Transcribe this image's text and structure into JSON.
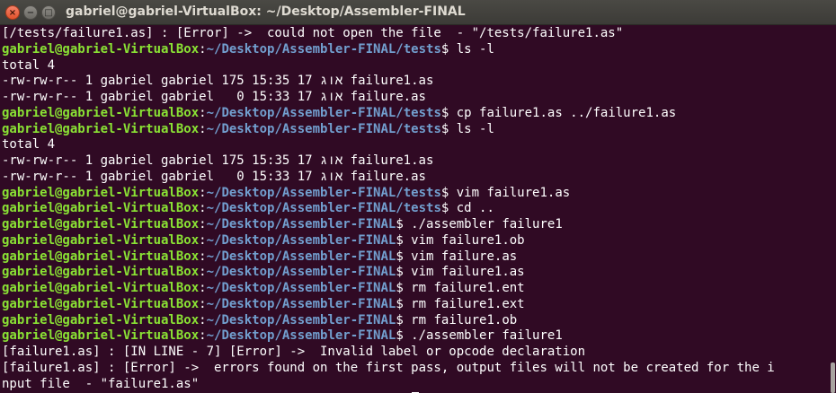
{
  "window": {
    "title": "gabriel@gabriel-VirtualBox: ~/Desktop/Assembler-FINAL",
    "close_glyph": "×",
    "min_glyph": "−",
    "max_glyph": "□"
  },
  "prompt": {
    "user_host": "gabriel@gabriel-VirtualBox",
    "sep": ":"
  },
  "lines": [
    {
      "kind": "out",
      "text": "[/tests/failure1.as] : [Error] ->  could not open the file  - \"/tests/failure1.as\""
    },
    {
      "kind": "cmd",
      "path": "~/Desktop/Assembler-FINAL/tests",
      "cmd": "$ ls -l"
    },
    {
      "kind": "out",
      "text": "total 4"
    },
    {
      "kind": "out",
      "text": "-rw-rw-r-- 1 gabriel gabriel 175 אוג 17 15:35 failure1.as"
    },
    {
      "kind": "out",
      "text": "-rw-rw-r-- 1 gabriel gabriel   0 אוג 17 15:33 failure.as"
    },
    {
      "kind": "cmd",
      "path": "~/Desktop/Assembler-FINAL/tests",
      "cmd": "$ cp failure1.as ../failure1.as"
    },
    {
      "kind": "cmd",
      "path": "~/Desktop/Assembler-FINAL/tests",
      "cmd": "$ ls -l"
    },
    {
      "kind": "out",
      "text": "total 4"
    },
    {
      "kind": "out",
      "text": "-rw-rw-r-- 1 gabriel gabriel 175 אוג 17 15:35 failure1.as"
    },
    {
      "kind": "out",
      "text": "-rw-rw-r-- 1 gabriel gabriel   0 אוג 17 15:33 failure.as"
    },
    {
      "kind": "cmd",
      "path": "~/Desktop/Assembler-FINAL/tests",
      "cmd": "$ vim failure1.as"
    },
    {
      "kind": "cmd",
      "path": "~/Desktop/Assembler-FINAL/tests",
      "cmd": "$ cd .."
    },
    {
      "kind": "cmd",
      "path": "~/Desktop/Assembler-FINAL",
      "cmd": "$ ./assembler failure1"
    },
    {
      "kind": "cmd",
      "path": "~/Desktop/Assembler-FINAL",
      "cmd": "$ vim failure1.ob"
    },
    {
      "kind": "cmd",
      "path": "~/Desktop/Assembler-FINAL",
      "cmd": "$ vim failure.as"
    },
    {
      "kind": "cmd",
      "path": "~/Desktop/Assembler-FINAL",
      "cmd": "$ vim failure1.as"
    },
    {
      "kind": "cmd",
      "path": "~/Desktop/Assembler-FINAL",
      "cmd": "$ rm failure1.ent"
    },
    {
      "kind": "cmd",
      "path": "~/Desktop/Assembler-FINAL",
      "cmd": "$ rm failure1.ext"
    },
    {
      "kind": "cmd",
      "path": "~/Desktop/Assembler-FINAL",
      "cmd": "$ rm failure1.ob"
    },
    {
      "kind": "cmd",
      "path": "~/Desktop/Assembler-FINAL",
      "cmd": "$ ./assembler failure1"
    },
    {
      "kind": "out",
      "text": "[failure1.as] : [IN LINE - 7] [Error] ->  Invalid label or opcode declaration"
    },
    {
      "kind": "out",
      "text": "[failure1.as] : [Error] ->  errors found on the first pass, output files will not be created for the i"
    },
    {
      "kind": "out",
      "text": "nput file  - \"failure1.as\""
    },
    {
      "kind": "cmd",
      "path": "~/Desktop/Assembler-FINAL",
      "cmd": "$ ",
      "cursor": true
    }
  ],
  "colors": {
    "background": "#300a24",
    "user_host": "#8ae234",
    "path": "#729fcf",
    "text": "#ffffff"
  }
}
